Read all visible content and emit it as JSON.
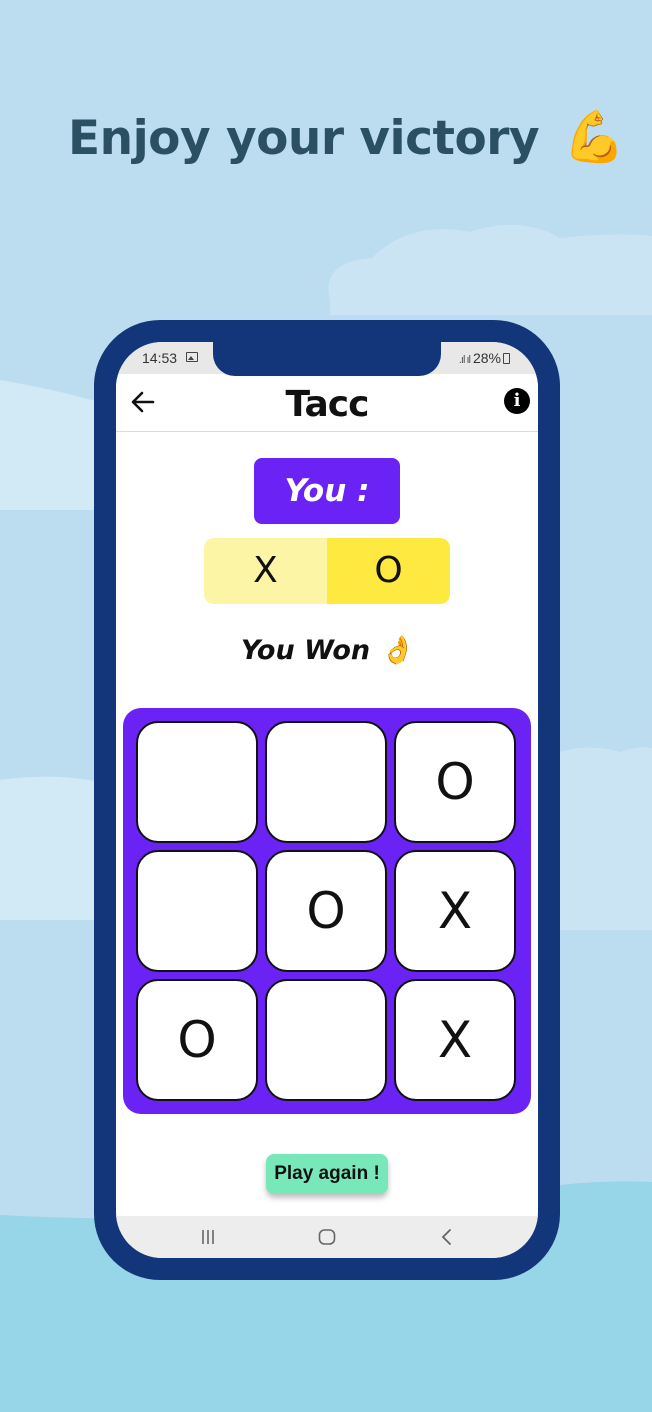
{
  "headline": {
    "text": "Enjoy your victory",
    "emoji": "💪"
  },
  "statusbar": {
    "time": "14:53",
    "signal": ".ıl ıl",
    "battery": "28%"
  },
  "appbar": {
    "title": "Tacc"
  },
  "badge": {
    "text": "You :"
  },
  "score": {
    "x_label": "X",
    "o_label": "O"
  },
  "result": {
    "text": "You Won 👌"
  },
  "board": {
    "cells": [
      "",
      "",
      "O",
      "",
      "O",
      "X",
      "O",
      "",
      "X"
    ]
  },
  "play_again": {
    "label": "Play again !"
  },
  "colors": {
    "background": "#bcdcf0",
    "phone_frame": "#13367a",
    "board": "#6a22f5",
    "badge": "#6a22f5",
    "score_x": "#fdf5a6",
    "score_o": "#fde940",
    "play_button": "#78e8ba",
    "headline": "#2b4f63"
  },
  "icons": [
    "back-arrow-icon",
    "info-icon",
    "gallery-icon",
    "signal-icon",
    "battery-icon",
    "recents-icon",
    "home-icon",
    "back-nav-icon"
  ]
}
